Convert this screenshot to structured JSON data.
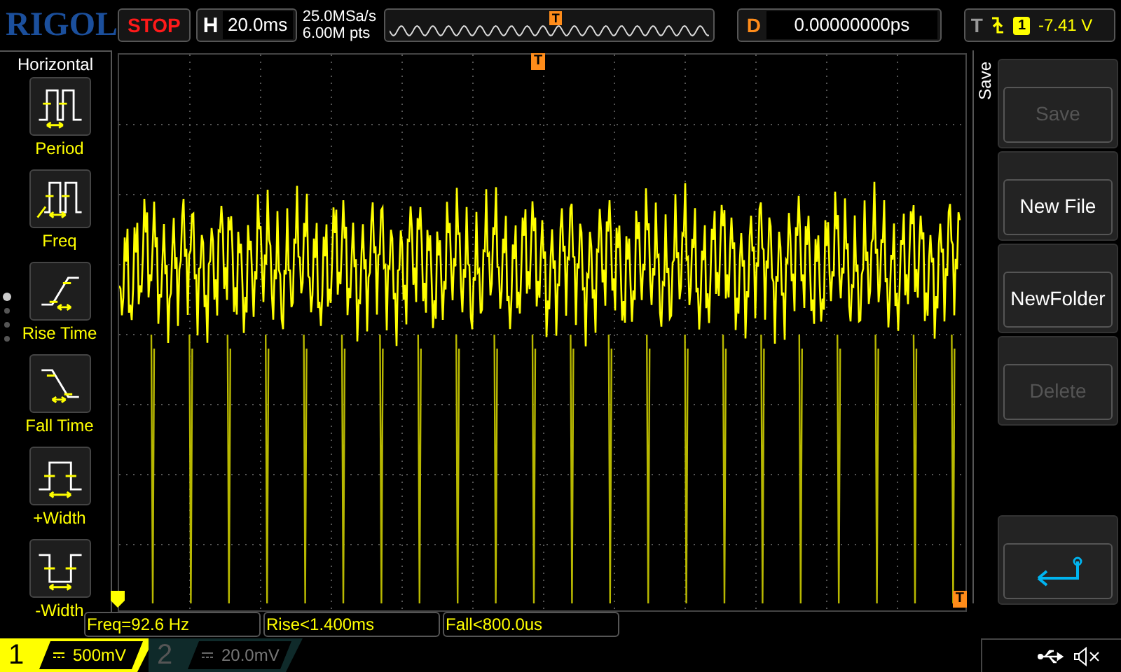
{
  "top_bar": {
    "logo": "RIGOL",
    "run_state": "STOP",
    "timebase": {
      "label": "H",
      "value": "20.0ms"
    },
    "sample_rate": "25.0MSa/s",
    "memory_depth": "6.00M pts",
    "overview_marker": "T",
    "delay": {
      "label": "D",
      "value": "0.00000000ps"
    },
    "trigger": {
      "label": "T",
      "source": "1",
      "level": "-7.41 V"
    }
  },
  "left_menu": {
    "title": "Horizontal",
    "items": [
      {
        "label": "Period",
        "kind": "period"
      },
      {
        "label": "Freq",
        "kind": "freq"
      },
      {
        "label": "Rise Time",
        "kind": "rise"
      },
      {
        "label": "Fall Time",
        "kind": "fall"
      },
      {
        "label": "+Width",
        "kind": "pwidth"
      },
      {
        "label": "-Width",
        "kind": "nwidth"
      }
    ],
    "pages": [
      {
        "selected": true
      },
      {
        "selected": false
      },
      {
        "selected": false
      },
      {
        "selected": false
      }
    ]
  },
  "display": {
    "trigger_position_marker": "T",
    "trigger_level_marker": "T"
  },
  "right_menu": {
    "title": "Save",
    "buttons": [
      {
        "label": "Save",
        "disabled": true
      },
      {
        "label": "New File",
        "disabled": false
      },
      {
        "label": "NewFolder",
        "disabled": false
      },
      {
        "label": "Delete",
        "disabled": true
      }
    ]
  },
  "measurements": [
    "Freq=92.6 Hz",
    "Rise<1.400ms",
    "Fall<800.0us"
  ],
  "channels": [
    {
      "number": "1",
      "scale": "500mV",
      "selected": true
    },
    {
      "number": "2",
      "scale": "20.0mV",
      "selected": false
    }
  ]
}
